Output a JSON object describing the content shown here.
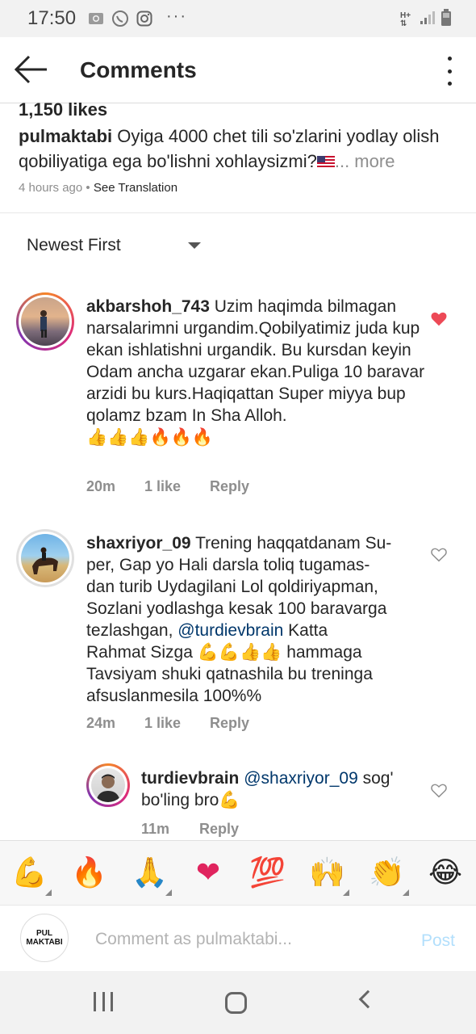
{
  "status_bar": {
    "time": "17:50",
    "network": "H+"
  },
  "header": {
    "title": "Comments"
  },
  "post": {
    "likes": "1,150 likes",
    "author": "pulmaktabi",
    "caption": "Oyiga 4000 chet tili so'zlarini yodlay olish qobiliyatiga ega bo'lishni xohlaysizmi?",
    "more": "... more",
    "time": "4 hours ago",
    "separator": "•",
    "see_translation": "See Translation"
  },
  "sort": {
    "label": "Newest First"
  },
  "comments": [
    {
      "username": "akbarshoh_743",
      "text": "Uzim haqimda bilmagan narsalarimni urgandim.Qobilyatimiz juda kup ekan ishlatishni urgandik. Bu kursdan keyin Odam ancha uzgarar ekan.Puliga 10 baravar arzidi bu kurs.Haqiqattan Super miyya bup qolamz bzam In Sha Alloh.",
      "emojis": "👍👍👍🔥🔥🔥",
      "time": "20m",
      "likes": "1 like",
      "reply": "Reply",
      "liked": true
    },
    {
      "username": "shaxriyor_09",
      "text_line1": "Trening haqqatdanam Su-",
      "text_line2": "per, Gap yo Hali darsla toliq tugamas-",
      "text_line3": "dan turib Uydagilani Lol qoldiriyapman,",
      "text_line4": "Sozlani yodlashga kesak 100 baravarga",
      "text_line5": "tezlashgan,",
      "mention": "@turdievbrain",
      "text_line5b": " Katta",
      "text_line6": "Rahmat Sizga",
      "emojis": "💪💪👍👍",
      "text_line6b": "hammaga",
      "text_line7": "Tavsiyam shuki qatnashila bu treninga",
      "text_line8": "afsuslanmesila 100%%",
      "time": "24m",
      "likes": "1 like",
      "reply": "Reply",
      "liked": false
    },
    {
      "username": "turdievbrain",
      "mention": "@shaxriyor_09",
      "text": " sog' bo'ling bro",
      "emojis": "💪",
      "time": "11m",
      "reply": "Reply",
      "liked": false
    }
  ],
  "reactions": [
    "💪",
    "🔥",
    "🙏",
    "❤",
    "💯",
    "🙌",
    "👏",
    "😂"
  ],
  "composer": {
    "avatar_text_line1": "PUL",
    "avatar_text_line2": "MAKTABI",
    "placeholder": "Comment as pulmaktabi...",
    "post_label": "Post"
  },
  "colors": {
    "heart_red": "#ed4956",
    "link_blue": "#00376b",
    "post_disabled": "#b2dffc",
    "meta_gray": "#8e8e8e"
  }
}
